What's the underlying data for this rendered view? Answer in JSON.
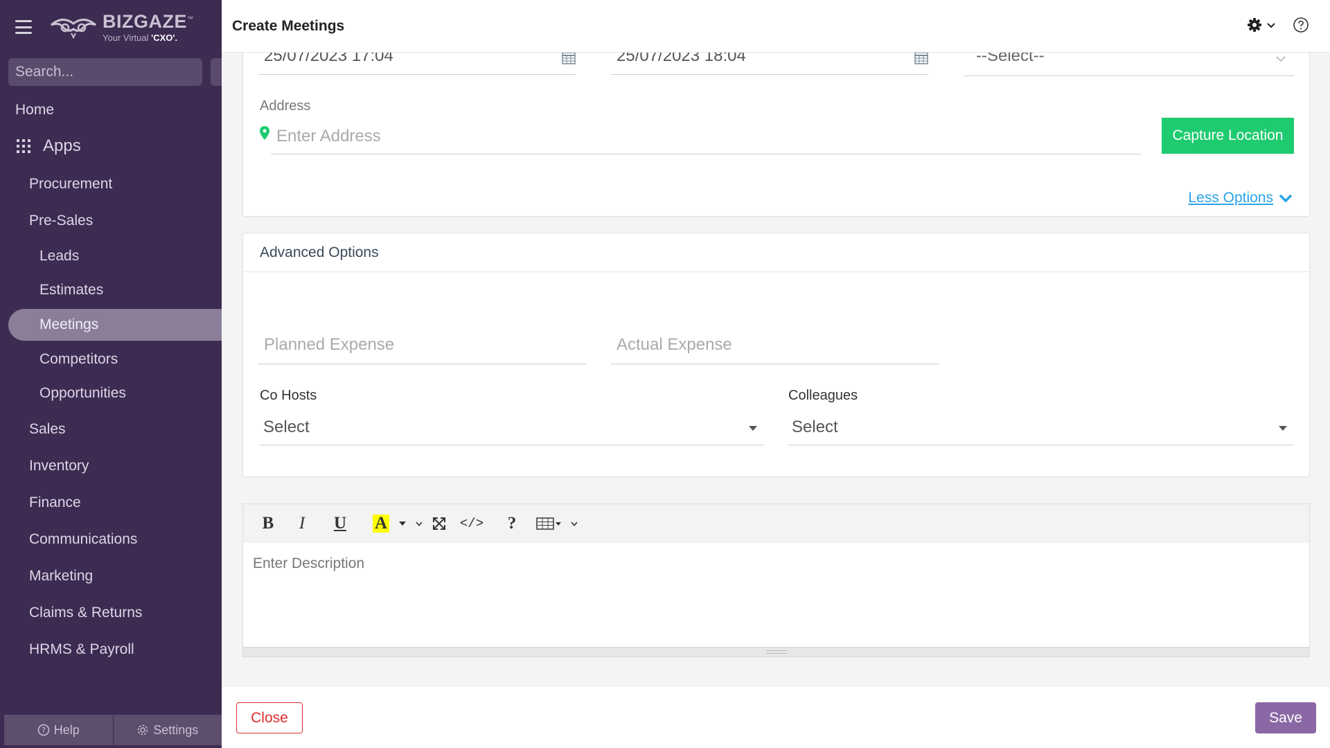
{
  "sidebar": {
    "brand": "BIZGAZE",
    "brand_tm": "™",
    "tagline_prefix": "Your Virtual ",
    "tagline_bold": "'CXO'.",
    "search_placeholder": "Search...",
    "home": "Home",
    "apps": "Apps",
    "groups": {
      "procurement": "Procurement",
      "presales": "Pre-Sales",
      "leads": "Leads",
      "estimates": "Estimates",
      "meetings": "Meetings",
      "competitors": "Competitors",
      "opportunities": "Opportunities",
      "sales": "Sales",
      "inventory": "Inventory",
      "finance": "Finance",
      "communications": "Communications",
      "marketing": "Marketing",
      "claims": "Claims & Returns",
      "hrms": "HRMS & Payroll"
    },
    "help": "Help",
    "settings": "Settings"
  },
  "header": {
    "title": "Create Meetings"
  },
  "form": {
    "start_datetime": "25/07/2023 17:04",
    "end_datetime": "25/07/2023 18:04",
    "select_value": "--Select--",
    "address_label": "Address",
    "address_placeholder": "Enter Address",
    "capture_location": "Capture Location",
    "less_options": "Less Options"
  },
  "advanced": {
    "title": "Advanced Options",
    "planned_expense_placeholder": "Planned Expense",
    "actual_expense_placeholder": "Actual Expense",
    "cohosts_label": "Co Hosts",
    "cohosts_value": "Select",
    "colleagues_label": "Colleagues",
    "colleagues_value": "Select"
  },
  "editor": {
    "bold": "B",
    "italic": "I",
    "underline": "U",
    "color": "A",
    "code": "</>",
    "help": "?",
    "placeholder": "Enter Description"
  },
  "footer": {
    "close": "Close",
    "save": "Save"
  },
  "colors": {
    "sidebar_bg": "#3d2b52",
    "active_item": "#8a7e98",
    "capture_button": "#1ecb6f",
    "link": "#2aa3e6",
    "close_border": "#e02b2b",
    "save_button": "#8b68a5"
  }
}
